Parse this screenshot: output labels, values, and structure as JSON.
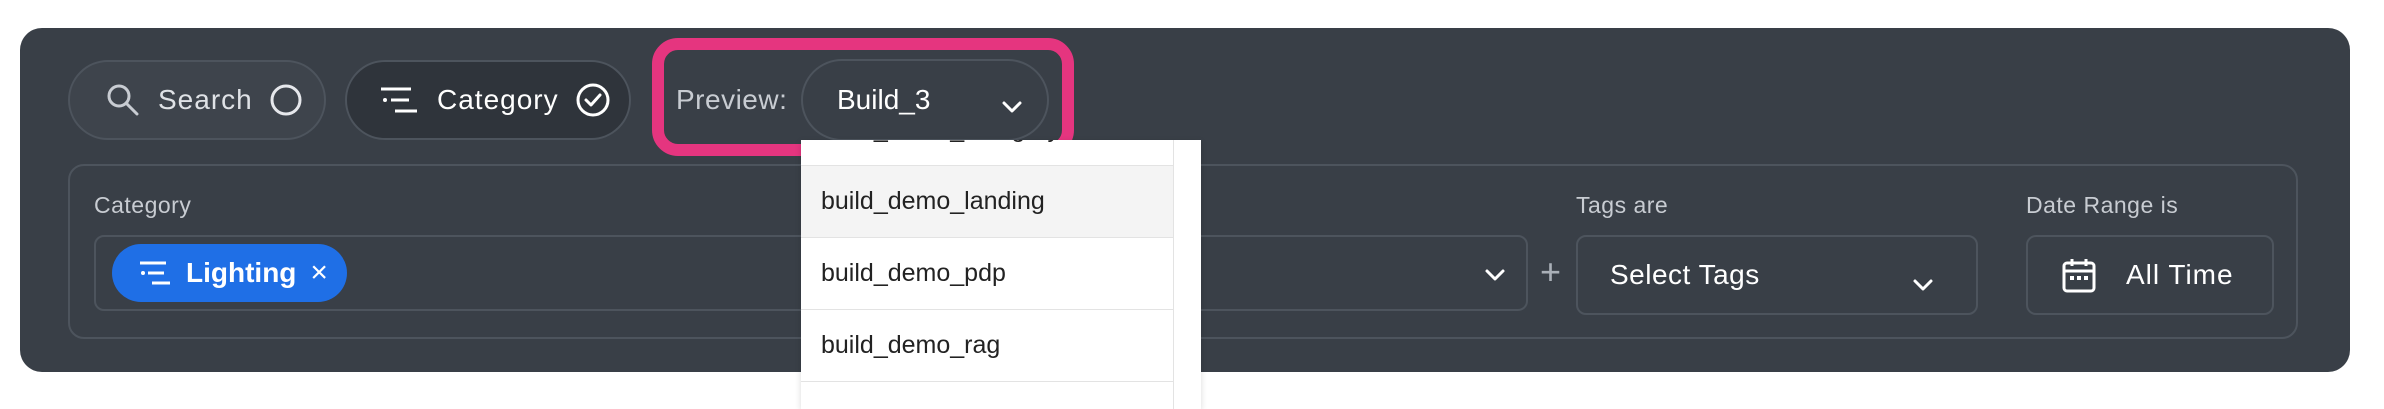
{
  "toolbar": {
    "search_label": "Search",
    "category_label": "Category",
    "preview_label": "Preview:",
    "preview_value": "Build_3"
  },
  "filters": {
    "category_label": "Category",
    "category_chip": "Lighting",
    "tags_label": "Tags are",
    "tags_value": "Select Tags",
    "date_label": "Date Range is",
    "date_value": "All Time",
    "plus": "+"
  },
  "dropdown": {
    "items": [
      "build_demo_category",
      "build_demo_landing",
      "build_demo_pdp",
      "build_demo_rag"
    ]
  },
  "colors": {
    "panel": "#393f47",
    "chip": "#1f6fe6",
    "highlight": "#e5357f"
  }
}
